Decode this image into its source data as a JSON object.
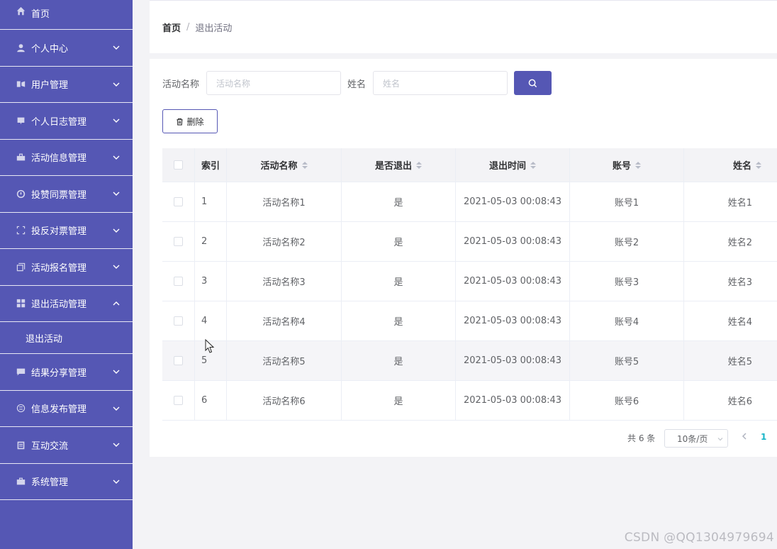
{
  "sidebar": {
    "items": [
      {
        "label": "首页",
        "icon": "home-icon"
      },
      {
        "label": "个人中心",
        "icon": "user-icon"
      },
      {
        "label": "用户管理",
        "icon": "users-icon"
      },
      {
        "label": "个人日志管理",
        "icon": "log-icon"
      },
      {
        "label": "活动信息管理",
        "icon": "activity-icon"
      },
      {
        "label": "投赞同票管理",
        "icon": "vote-up-icon"
      },
      {
        "label": "投反对票管理",
        "icon": "vote-down-icon"
      },
      {
        "label": "活动报名管理",
        "icon": "signup-icon"
      },
      {
        "label": "退出活动管理",
        "icon": "grid-icon"
      },
      {
        "label": "结果分享管理",
        "icon": "share-icon"
      },
      {
        "label": "信息发布管理",
        "icon": "publish-icon"
      },
      {
        "label": "互动交流",
        "icon": "chat-icon"
      },
      {
        "label": "系统管理",
        "icon": "system-icon"
      }
    ],
    "sub_item": "退出活动"
  },
  "breadcrumb": {
    "home": "首页",
    "separator": "/",
    "current": "退出活动"
  },
  "search": {
    "activity_label": "活动名称",
    "activity_placeholder": "活动名称",
    "name_label": "姓名",
    "name_placeholder": "姓名"
  },
  "toolbar": {
    "delete_label": "删除"
  },
  "table": {
    "headers": {
      "index": "索引",
      "activity": "活动名称",
      "quit": "是否退出",
      "time": "退出时间",
      "account": "账号",
      "name": "姓名"
    },
    "rows": [
      {
        "index": "1",
        "activity": "活动名称1",
        "quit": "是",
        "time": "2021-05-03 00:08:43",
        "account": "账号1",
        "name": "姓名1"
      },
      {
        "index": "2",
        "activity": "活动名称2",
        "quit": "是",
        "time": "2021-05-03 00:08:43",
        "account": "账号2",
        "name": "姓名2"
      },
      {
        "index": "3",
        "activity": "活动名称3",
        "quit": "是",
        "time": "2021-05-03 00:08:43",
        "account": "账号3",
        "name": "姓名3"
      },
      {
        "index": "4",
        "activity": "活动名称4",
        "quit": "是",
        "time": "2021-05-03 00:08:43",
        "account": "账号4",
        "name": "姓名4"
      },
      {
        "index": "5",
        "activity": "活动名称5",
        "quit": "是",
        "time": "2021-05-03 00:08:43",
        "account": "账号5",
        "name": "姓名5"
      },
      {
        "index": "6",
        "activity": "活动名称6",
        "quit": "是",
        "time": "2021-05-03 00:08:43",
        "account": "账号6",
        "name": "姓名6"
      }
    ]
  },
  "pagination": {
    "total_text": "共 6 条",
    "page_size": "10条/页",
    "current_page": "1"
  },
  "watermark": "CSDN @QQ1304979694",
  "colors": {
    "sidebar": "#5557b4",
    "accent": "#5557b4",
    "page_active": "#19b5c8"
  }
}
